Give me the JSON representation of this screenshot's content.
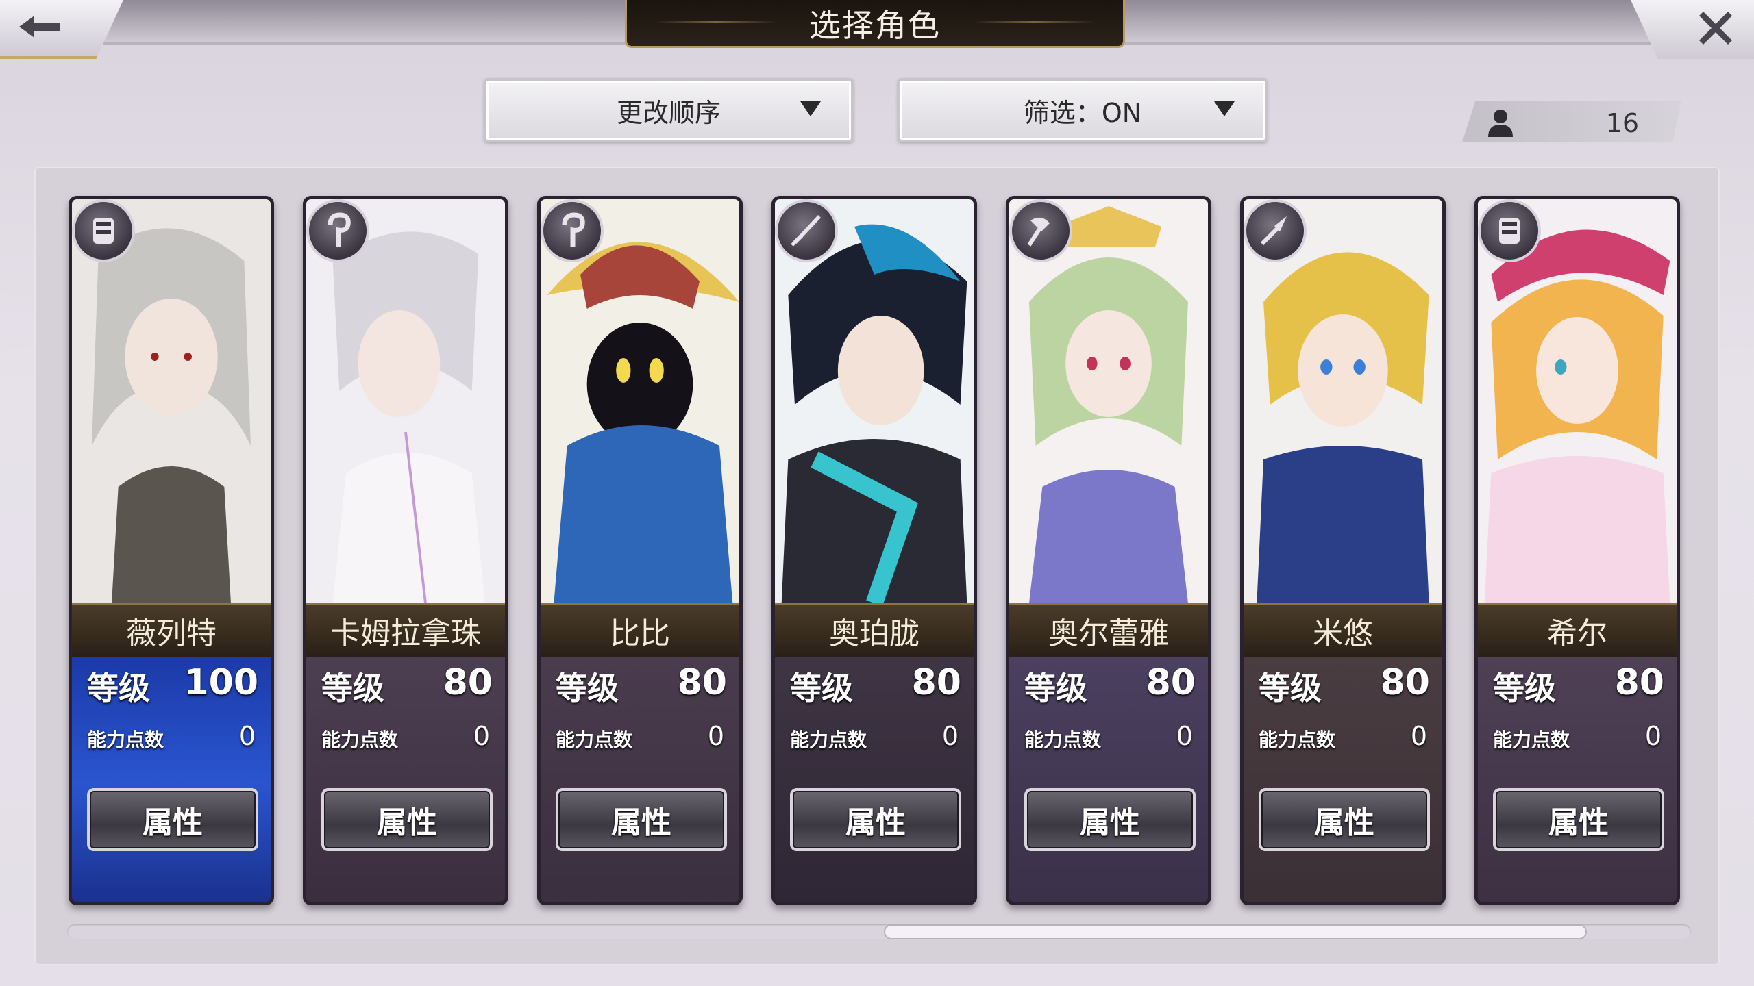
{
  "header": {
    "title": "选择角色",
    "back_icon": "arrow-left-icon",
    "close_icon": "close-icon"
  },
  "toolbar": {
    "sort_label": "更改顺序",
    "filter_label": "筛选：ON",
    "party_count": "16"
  },
  "labels": {
    "level": "等级",
    "ability_points": "能力点数",
    "attributes_button": "属性"
  },
  "characters": [
    {
      "name": "薇列特",
      "level": "100",
      "ability_points": "0",
      "class_icon": "gauntlet-icon",
      "accent": "#2a4fb8"
    },
    {
      "name": "卡姆拉拿珠",
      "level": "80",
      "ability_points": "0",
      "class_icon": "staff-icon",
      "accent": "#4a3b4f"
    },
    {
      "name": "比比",
      "level": "80",
      "ability_points": "0",
      "class_icon": "staff-icon",
      "accent": "#4a3b4f"
    },
    {
      "name": "奥珀胧",
      "level": "80",
      "ability_points": "0",
      "class_icon": "sword-icon",
      "accent": "#4a3b4f"
    },
    {
      "name": "奥尔蕾雅",
      "level": "80",
      "ability_points": "0",
      "class_icon": "axe-icon",
      "accent": "#4a3b4f"
    },
    {
      "name": "米悠",
      "level": "80",
      "ability_points": "0",
      "class_icon": "spear-icon",
      "accent": "#4a3b4f"
    },
    {
      "name": "希尔",
      "level": "80",
      "ability_points": "0",
      "class_icon": "gauntlet-icon",
      "accent": "#4a3b4f"
    }
  ]
}
